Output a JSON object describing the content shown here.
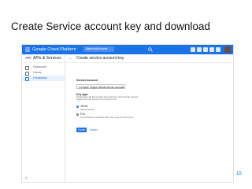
{
  "slide": {
    "title": "Create Service account key and download",
    "page_number": "15"
  },
  "console": {
    "brand": "Google Cloud Platform",
    "project": "NationalAccounts",
    "header_color": "#1a73e8",
    "sidebar": {
      "title": "APIs & Services",
      "api_label": "API",
      "items": [
        {
          "label": "Dashboard",
          "icon": "dashboard-icon",
          "active": false
        },
        {
          "label": "Library",
          "icon": "library-icon",
          "active": false
        },
        {
          "label": "Credentials",
          "icon": "key-icon",
          "active": true
        }
      ]
    },
    "page_title": "Create service account key",
    "form": {
      "service_account_label": "Service account",
      "service_account_value": "Compute Engine default service account",
      "key_type_label": "Key type",
      "key_type_help": "Downloads a file that contains the private key. Store the file securely because this key cannot be recovered if lost.",
      "options": [
        {
          "label": "JSON",
          "sublabel": "Recommended",
          "checked": true
        },
        {
          "label": "P12",
          "sublabel": "For backward compatibility with code using the P12 format",
          "checked": false
        }
      ],
      "create_label": "Create",
      "cancel_label": "Cancel"
    }
  }
}
